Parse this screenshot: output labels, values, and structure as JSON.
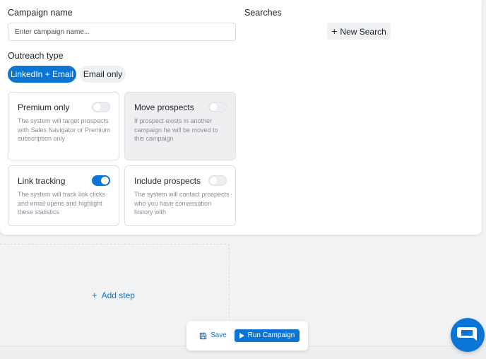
{
  "campaign": {
    "name_label": "Campaign name",
    "name_placeholder": "Enter campaign name...",
    "name_value": ""
  },
  "searches": {
    "label": "Searches",
    "new_search_label": "New Search"
  },
  "outreach": {
    "label": "Outreach type",
    "options": [
      "LinkedIn + Email",
      "Email only"
    ],
    "selected": "LinkedIn + Email"
  },
  "settings": [
    {
      "title": "Premium only",
      "description": "The system will target prospects with Sales Navigator or Premium subscription only",
      "enabled": false
    },
    {
      "title": "Move prospects",
      "description": "If prospect exists in another campaign he will be moved to this campaign",
      "enabled": false
    },
    {
      "title": "Link tracking",
      "description": "The system will track link clicks and email opens and highlight these statistics",
      "enabled": true
    },
    {
      "title": "Include prospects",
      "description": "The system will contact prospects who you have conversation history with",
      "enabled": false
    }
  ],
  "steps": {
    "add_step_label": "Add step"
  },
  "actions": {
    "save_label": "Save",
    "run_label": "Run Campaign"
  },
  "icons": {
    "plus": "plus-icon",
    "save": "floppy-disk-icon",
    "run": "play-icon",
    "chat": "chat-bubble-icon"
  },
  "colors": {
    "accent": "#0a75d4",
    "background": "#f1f2f4",
    "card": "#ffffff"
  }
}
